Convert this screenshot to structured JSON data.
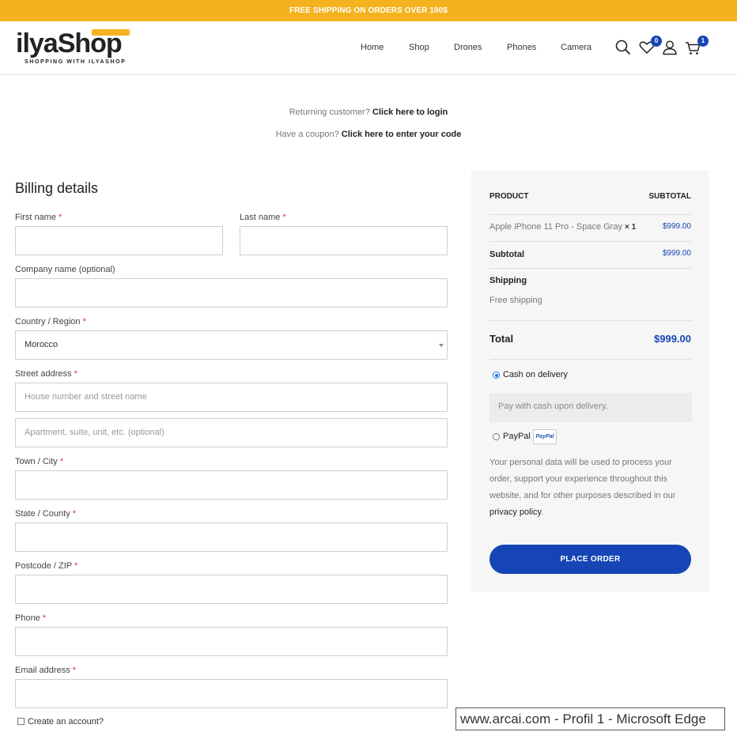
{
  "topbar": {
    "text": "FREE SHIPPING ON ORDERS OVER 100$"
  },
  "logo": {
    "name_a": "ilya",
    "name_b": "Shop",
    "tagline": "SHOPPING WITH ILYASHOP"
  },
  "nav": {
    "items": [
      "Home",
      "Shop",
      "Drones",
      "Phones",
      "Camera"
    ]
  },
  "header_icons": {
    "search": "search-icon",
    "wishlist": "heart-icon",
    "wishlist_count": "0",
    "account": "user-icon",
    "cart": "cart-icon",
    "cart_count": "1"
  },
  "notices": {
    "login_prefix": "Returning customer?",
    "login_link": "Click here to login",
    "coupon_prefix": "Have a coupon?",
    "coupon_link": "Click here to enter your code"
  },
  "billing": {
    "title": "Billing details",
    "required_mark": "*",
    "first_name": "First name",
    "last_name": "Last name",
    "company": "Company name (optional)",
    "country": "Country / Region",
    "country_value": "Morocco",
    "street": "Street address",
    "street_placeholder": "House number and street name",
    "apartment_placeholder": "Apartment, suite, unit, etc. (optional)",
    "city": "Town / City",
    "state": "State / County",
    "postcode": "Postcode / ZIP",
    "phone": "Phone",
    "email": "Email address",
    "create_account": "Create an account?"
  },
  "order": {
    "product_header": "PRODUCT",
    "subtotal_header": "SUBTOTAL",
    "item_name": "Apple iPhone 11 Pro - Space Gray",
    "item_qty": "× 1",
    "item_price": "$999.00",
    "subtotal_label": "Subtotal",
    "subtotal_value": "$999.00",
    "shipping_label": "Shipping",
    "shipping_value": "Free shipping",
    "total_label": "Total",
    "total_value": "$999.00",
    "payment_cod": "Cash on delivery",
    "payment_cod_desc": "Pay with cash upon delivery.",
    "payment_paypal": "PayPal",
    "paypal_logo_text": "PayPal",
    "privacy_text": "Your personal data will be used to process your order, support your experience throughout this website, and for other purposes described in our",
    "privacy_link": "privacy policy",
    "privacy_end": ".",
    "place_order": "PLACE ORDER"
  },
  "tooltip": {
    "text": "www.arcai.com - Profil 1 - Microsoft Edge"
  },
  "colors": {
    "accent": "#f5b21f",
    "brand_blue": "#1646b5",
    "radio_blue": "#1a73e8"
  }
}
